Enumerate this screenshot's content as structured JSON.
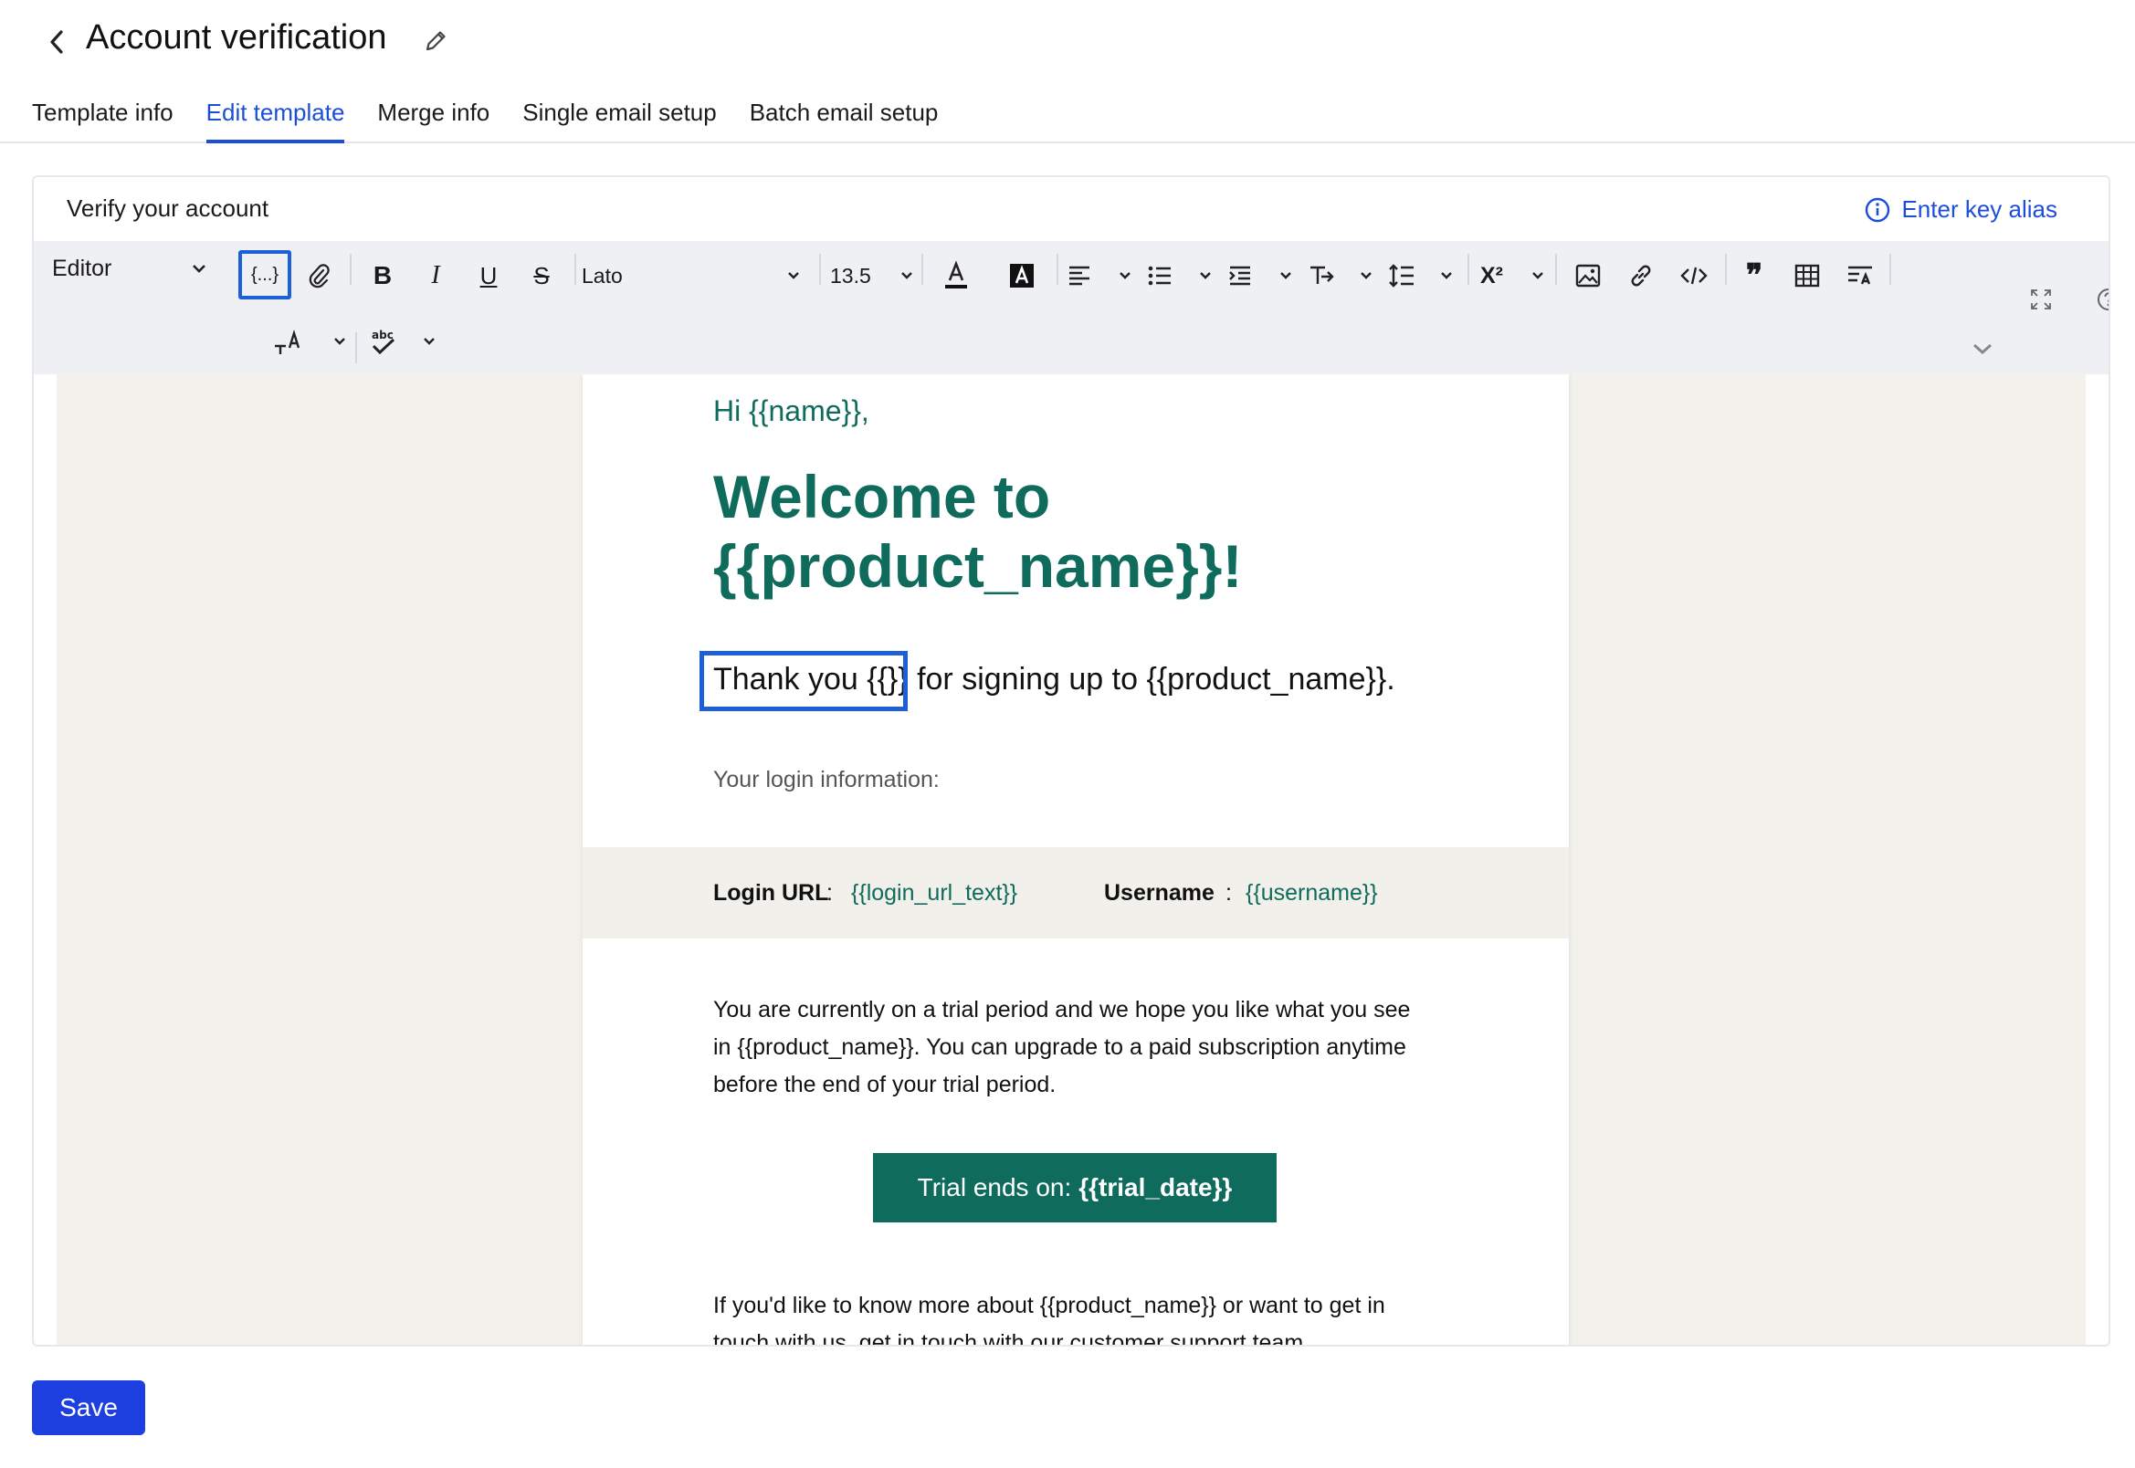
{
  "header": {
    "title": "Account verification",
    "tabs": [
      {
        "label": "Template info",
        "active": false
      },
      {
        "label": "Edit template",
        "active": true
      },
      {
        "label": "Merge info",
        "active": false
      },
      {
        "label": "Single email setup",
        "active": false
      },
      {
        "label": "Batch email setup",
        "active": false
      }
    ]
  },
  "editor": {
    "subject": "Verify your account",
    "alias_link": "Enter key alias",
    "toolbar": {
      "mode": "Editor",
      "merge_field": "{...}",
      "font": "Lato",
      "size": "13.5"
    }
  },
  "email": {
    "greeting": "Hi {{name}},",
    "welcome": "Welcome to {{product_name}}!",
    "thanks": "Thank you {{}} for signing up to {{product_name}}.",
    "login_info": "Your login information:",
    "login_url_label": "Login URL",
    "login_url_value": "{{login_url_text}}",
    "username_label": "Username",
    "username_value": "{{username}}",
    "trial_para_1": "You are currently on a trial period and we hope you like what you see",
    "trial_para_2": "in {{product_name}}. You can upgrade to a paid subscription anytime",
    "trial_para_3": "before the end of your trial period.",
    "cta_prefix": "Trial ends on:",
    "cta_value": "{{trial_date}}",
    "support_1": "If you'd like to know more about {{product_name}} or want to get in",
    "support_2": "touch with us, get in touch with our customer support team."
  },
  "actions": {
    "save": "Save"
  },
  "colors": {
    "accent": "#1d4ed8",
    "brand_green": "#0f6b5c",
    "save_bg": "#1d3fe0"
  }
}
